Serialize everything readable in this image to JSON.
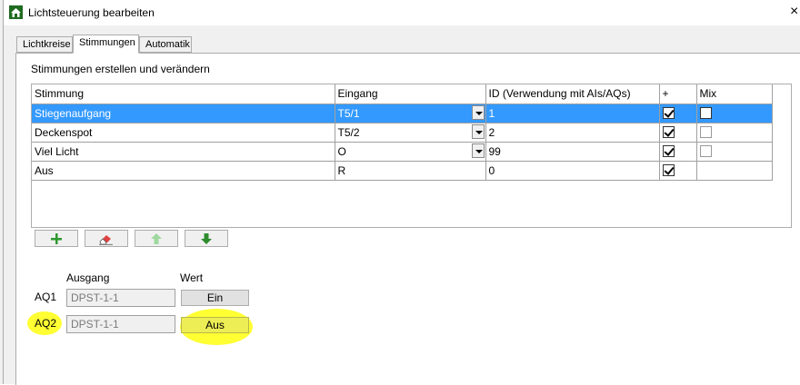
{
  "window": {
    "title": "Lichtsteuerung bearbeiten",
    "close_glyph": "×"
  },
  "tabs": [
    {
      "label": "Lichtkreise"
    },
    {
      "label": "Stimmungen"
    },
    {
      "label": "Automatik"
    }
  ],
  "active_tab": "Stimmungen",
  "section_label": "Stimmungen erstellen und verändern",
  "table": {
    "columns": [
      "Stimmung",
      "Eingang",
      "ID (Verwendung mit AIs/AQs)",
      "+",
      "Mix"
    ],
    "rows": [
      {
        "stimmung": "Stiegenaufgang",
        "eingang": "T5/1",
        "id": "1",
        "plus": true,
        "mix": false,
        "selected": true
      },
      {
        "stimmung": "Deckenspot",
        "eingang": "T5/2",
        "id": "2",
        "plus": true,
        "mix": false,
        "selected": false
      },
      {
        "stimmung": "Viel Licht",
        "eingang": "O",
        "id": "99",
        "plus": true,
        "mix": false,
        "selected": false
      },
      {
        "stimmung": "Aus",
        "eingang": "R",
        "id": "0",
        "plus": true,
        "mix": null,
        "selected": false
      }
    ]
  },
  "toolbar": {
    "buttons": [
      {
        "name": "add",
        "icon": "plus-icon"
      },
      {
        "name": "delete",
        "icon": "eraser-icon"
      },
      {
        "name": "move-up",
        "icon": "arrow-up-icon"
      },
      {
        "name": "move-down",
        "icon": "arrow-down-icon"
      }
    ]
  },
  "outputs": {
    "header_output": "Ausgang",
    "header_value": "Wert",
    "rows": [
      {
        "label": "AQ1",
        "output": "DPST-1-1",
        "value": "Ein"
      },
      {
        "label": "AQ2",
        "output": "DPST-1-1",
        "value": "Aus"
      }
    ]
  },
  "colors": {
    "selection": "#3399ff",
    "highlight": "#ffff33",
    "app_icon": "#1e6b20",
    "add_icon": "#2e9a2e",
    "arrow_icon": "#2e8b2e"
  }
}
